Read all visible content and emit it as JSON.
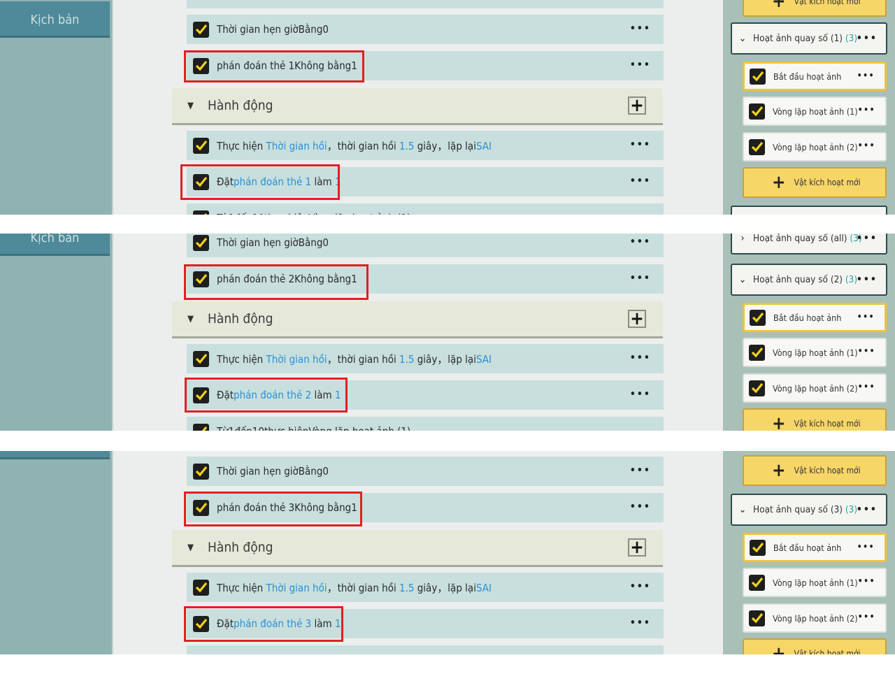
{
  "sidebar": {
    "scenario_label": "Kịch bản"
  },
  "common": {
    "dots": "•••",
    "timer_green": "Thời gian hẹn giờBằng0",
    "actions_header": "Hành động",
    "exec_prefix": "Thực hiện ",
    "exec_link": "Thời gian hồi",
    "exec_mid": "，thời gian hồi ",
    "exec_val": "1.5",
    "exec_unit": " giây，lặp lại",
    "exec_sai": "SAI",
    "set_prefix": "Đặt",
    "set_suffix_mid": " làm ",
    "set_val": "1",
    "loop_partial": "Từ1đến10thực hiệnVòng lặp hoạt ảnh (1)"
  },
  "panels": [
    {
      "judge": "phán đoán thẻ 1Không bằng1",
      "set_target": "phán đoán thẻ 1"
    },
    {
      "judge": "phán đoán thẻ 2Không bằng1",
      "set_target": "phán đoán thẻ 2"
    },
    {
      "judge": "phán đoán thẻ 3Không bằng1",
      "set_target": "phán đoán thẻ 3"
    }
  ],
  "right": {
    "group1": {
      "label": "Hoạt ảnh quay số (1)",
      "count": "(3)"
    },
    "group_all": {
      "label": "Hoạt ảnh quay số (all)",
      "count": "(3)"
    },
    "group2": {
      "label": "Hoạt ảnh quay số (2)",
      "count": "(3)"
    },
    "group3": {
      "label": "Hoạt ảnh quay số (3)",
      "count": "(3)"
    },
    "start_anim": "Bắt đầu hoạt ảnh",
    "loop1": "Vòng lặp hoạt ảnh (1)",
    "loop2": "Vòng lặp hoạt ảnh (2)",
    "new_trigger": "Vật kích hoạt mới",
    "card_dots": "•••"
  }
}
